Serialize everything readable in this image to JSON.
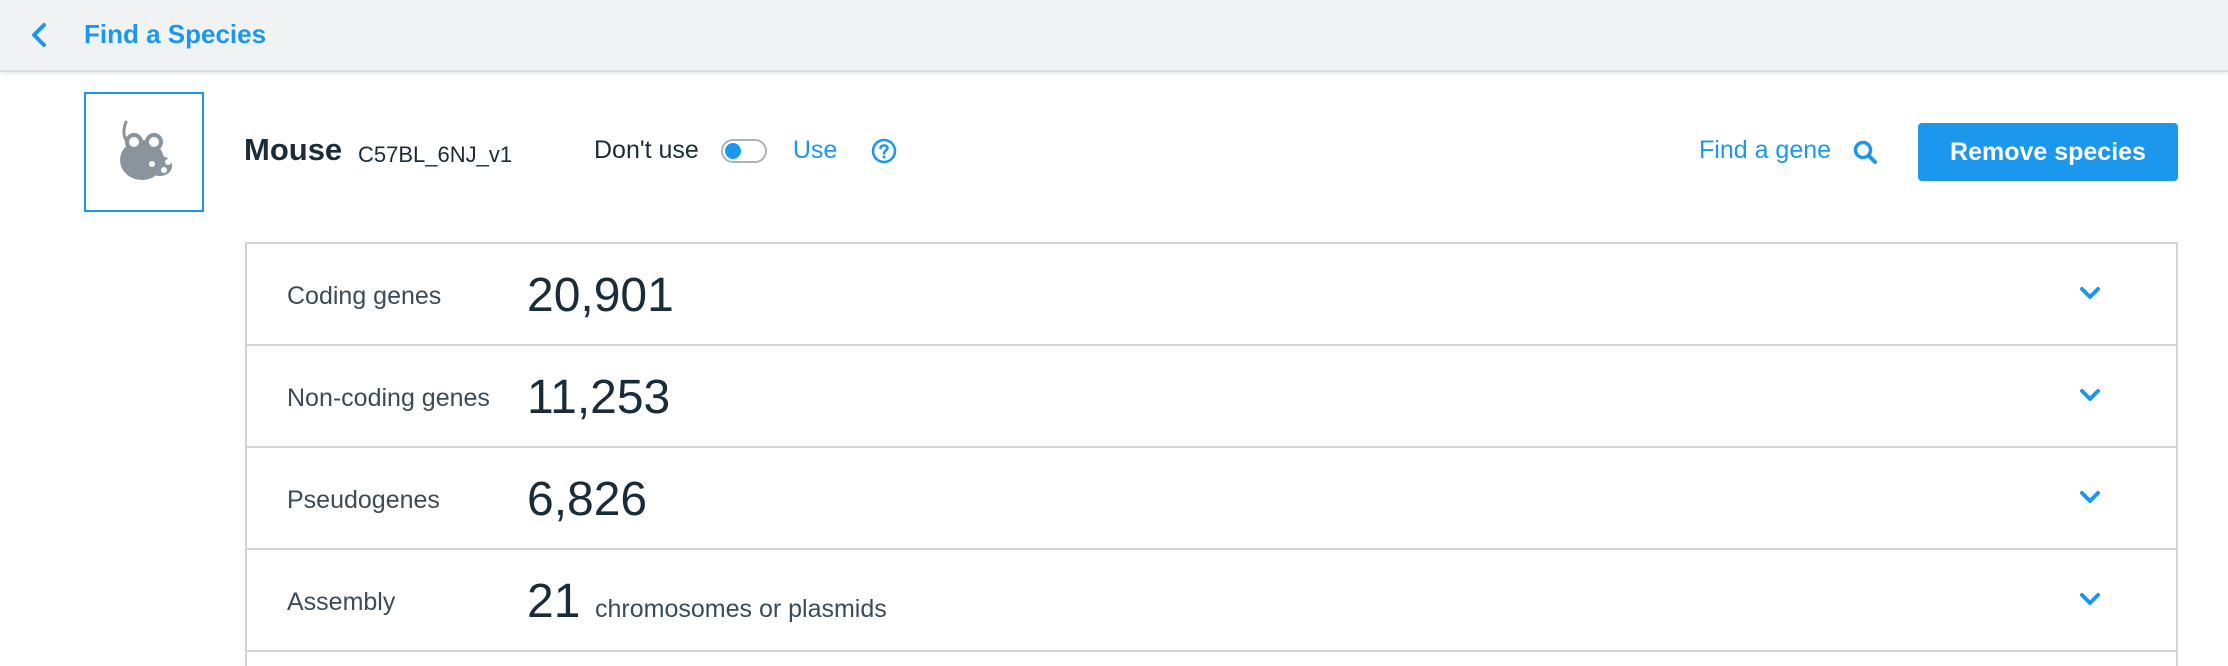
{
  "topbar": {
    "back_icon": "chevron-left-icon",
    "title": "Find a Species"
  },
  "species": {
    "thumbnail_icon": "mouse-icon",
    "name": "Mouse",
    "assembly": "C57BL_6NJ_v1",
    "dont_use_label": "Don't use",
    "use_label": "Use",
    "toggle_state": "dont_use",
    "help_icon": "question-circle-icon",
    "find_gene_label": "Find a gene",
    "search_icon": "search-icon",
    "remove_label": "Remove species"
  },
  "stats": [
    {
      "label": "Coding genes",
      "value": "20,901",
      "unit": ""
    },
    {
      "label": "Non-coding genes",
      "value": "11,253",
      "unit": ""
    },
    {
      "label": "Pseudogenes",
      "value": "6,826",
      "unit": ""
    },
    {
      "label": "Assembly",
      "value": "21",
      "unit": "chromosomes or plasmids"
    }
  ],
  "colors": {
    "accent": "#1b98ee",
    "text": "#1b2c39",
    "topbar_bg": "#f1f2f4",
    "border": "#d0d4d8",
    "icon_grey": "#8a949d"
  }
}
